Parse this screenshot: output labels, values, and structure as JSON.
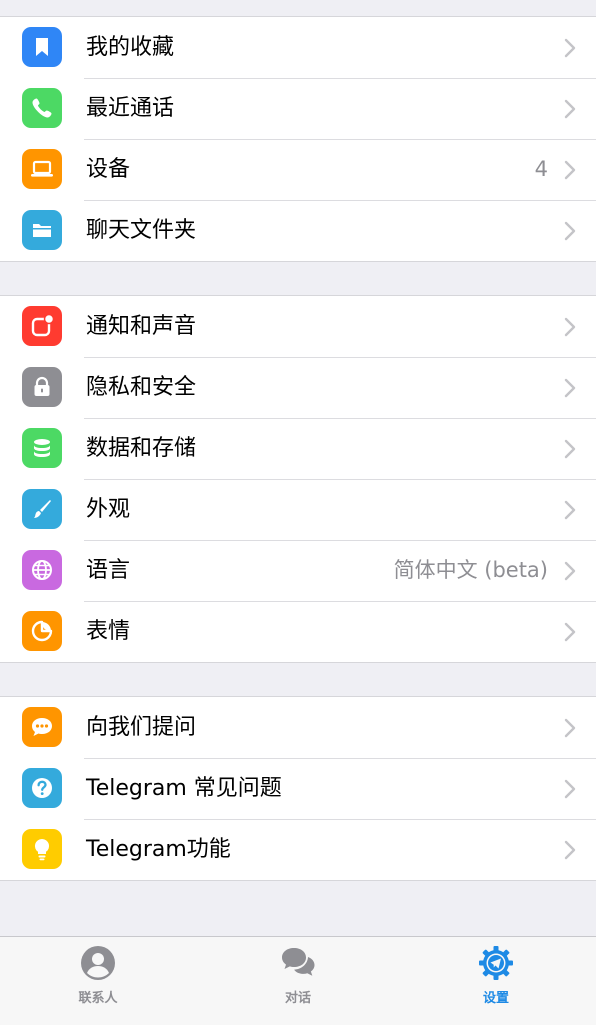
{
  "colors": {
    "accent": "#1e8ae5",
    "background": "#efeff4",
    "secondary_text": "#8e8e93",
    "chevron": "#c4c4c8"
  },
  "section1": {
    "items": [
      {
        "label": "我的收藏",
        "icon": "bookmark-icon",
        "color": "#2f86f6"
      },
      {
        "label": "最近通话",
        "icon": "phone-icon",
        "color": "#4cd964"
      },
      {
        "label": "设备",
        "icon": "laptop-icon",
        "color": "#ff9500",
        "value": "4"
      },
      {
        "label": "聊天文件夹",
        "icon": "folder-icon",
        "color": "#34aadc"
      }
    ]
  },
  "section2": {
    "items": [
      {
        "label": "通知和声音",
        "icon": "notification-icon",
        "color": "#ff3b30"
      },
      {
        "label": "隐私和安全",
        "icon": "lock-icon",
        "color": "#8e8e93"
      },
      {
        "label": "数据和存储",
        "icon": "database-icon",
        "color": "#4cd964"
      },
      {
        "label": "外观",
        "icon": "brush-icon",
        "color": "#34aadc"
      },
      {
        "label": "语言",
        "icon": "globe-icon",
        "color": "#c969e0",
        "value": "简体中文 (beta)"
      },
      {
        "label": "表情",
        "icon": "sticker-icon",
        "color": "#ff9500"
      }
    ]
  },
  "section3": {
    "items": [
      {
        "label": "向我们提问",
        "icon": "chat-bubble-icon",
        "color": "#ff9500"
      },
      {
        "label": "Telegram 常见问题",
        "icon": "question-icon",
        "color": "#34aadc"
      },
      {
        "label": "Telegram功能",
        "icon": "lightbulb-icon",
        "color": "#ffcc00"
      }
    ]
  },
  "tabbar": {
    "tabs": [
      {
        "label": "联系人",
        "icon": "person-icon",
        "active": false
      },
      {
        "label": "对话",
        "icon": "chats-icon",
        "active": false
      },
      {
        "label": "设置",
        "icon": "settings-gear-icon",
        "active": true
      }
    ]
  }
}
